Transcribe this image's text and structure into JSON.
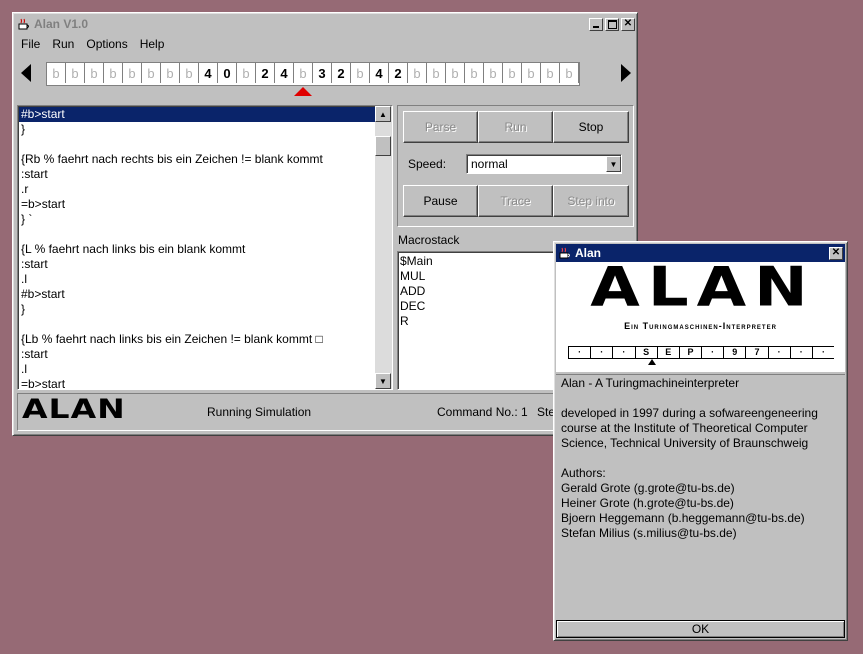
{
  "main_window": {
    "title": "Alan V1.0",
    "menu": [
      "File",
      "Run",
      "Options",
      "Help"
    ],
    "tape": [
      "b",
      "b",
      "b",
      "b",
      "b",
      "b",
      "b",
      "b",
      "4",
      "0",
      "b",
      "2",
      "4",
      "b",
      "3",
      "2",
      "b",
      "4",
      "2",
      "b",
      "b",
      "b",
      "b",
      "b",
      "b",
      "b",
      "b",
      "b"
    ],
    "tape_head_index": 13,
    "code_lines": [
      "#b>start",
      "}",
      "",
      "{Rb % faehrt nach rechts bis ein Zeichen != blank kommt",
      ":start",
      ".r",
      "=b>start",
      "} `",
      "",
      "{L % faehrt nach links bis ein blank kommt",
      ":start",
      ".l",
      "#b>start",
      "}",
      "",
      "{Lb % faehrt nach links bis ein Zeichen != blank kommt □",
      ":start",
      ".l",
      "=b>start"
    ],
    "buttons": {
      "parse": "Parse",
      "run": "Run",
      "stop": "Stop",
      "pause": "Pause",
      "trace": "Trace",
      "step_into": "Step into"
    },
    "speed_label": "Speed:",
    "speed_value": "normal",
    "macrostack_label": "Macrostack",
    "macrostack": [
      "$Main",
      "MUL",
      "ADD",
      "DEC",
      "R"
    ],
    "status": {
      "logo": "ALAN",
      "state": "Running Simulation",
      "command": "Command No.: 1",
      "step_partial": "Ste"
    }
  },
  "about_dialog": {
    "title": "Alan",
    "logo_big": "ALAN",
    "logo_sub": "Ein Turingmaschinen-Interpreter",
    "logo_tape": [
      "·",
      "·",
      "·",
      "S",
      "E",
      "P",
      "·",
      "9",
      "7",
      "·",
      "·",
      "·"
    ],
    "lines": [
      "Alan - A Turingmachineinterpreter",
      "",
      "developed in 1997 during a sofwareengeneering",
      "course at the Institute of Theoretical Computer",
      "Science, Technical University of Braunschweig",
      "",
      "Authors:",
      "Gerald Grote (g.grote@tu-bs.de)",
      "Heiner Grote (h.grote@tu-bs.de)",
      "Bjoern Heggemann (b.heggemann@tu-bs.de)",
      "Stefan Milius (s.milius@tu-bs.de)"
    ],
    "ok": "OK"
  },
  "colors": {
    "desktop": "#966a75",
    "selection": "#0a246a",
    "head_marker": "#e00000"
  }
}
